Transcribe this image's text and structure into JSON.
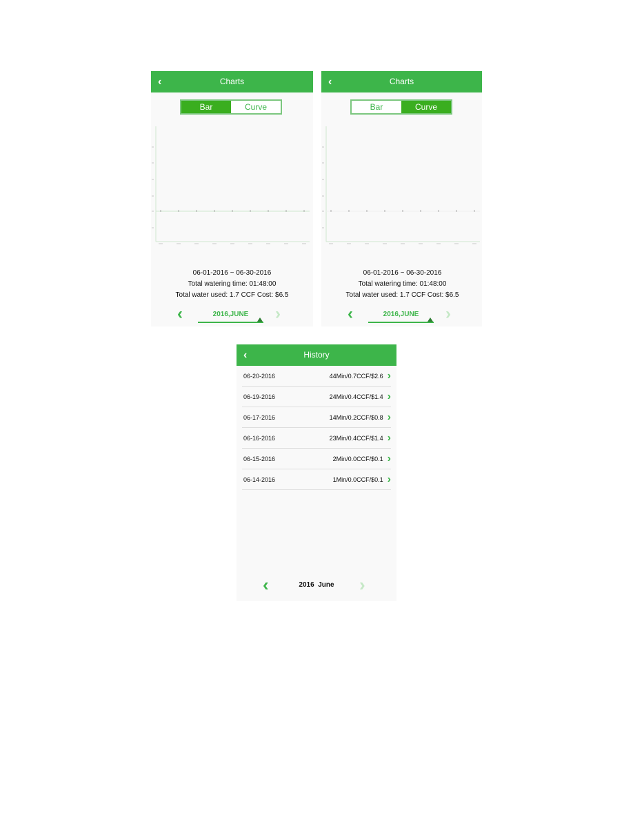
{
  "charts_screens": [
    {
      "title": "Charts",
      "tabs": [
        "Bar",
        "Curve"
      ],
      "active": "Bar",
      "range": "06-01-2016 ~ 06-30-2016",
      "time": "Total watering time: 01:48:00",
      "water": "Total water used: 1.7 CCF  Cost: $6.5",
      "period": "2016,JUNE"
    },
    {
      "title": "Charts",
      "tabs": [
        "Bar",
        "Curve"
      ],
      "active": "Curve",
      "range": "06-01-2016 ~ 06-30-2016",
      "time": "Total watering time: 01:48:00",
      "water": "Total water used: 1.7 CCF  Cost: $6.5",
      "period": "2016,JUNE"
    }
  ],
  "history": {
    "title": "History",
    "rows": [
      {
        "date": "06-20-2016",
        "value": "44Min/0.7CCF/$2.6"
      },
      {
        "date": "06-19-2016",
        "value": "24Min/0.4CCF/$1.4"
      },
      {
        "date": "06-17-2016",
        "value": "14Min/0.2CCF/$0.8"
      },
      {
        "date": "06-16-2016",
        "value": "23Min/0.4CCF/$1.4"
      },
      {
        "date": "06-15-2016",
        "value": "2Min/0.0CCF/$0.1"
      },
      {
        "date": "06-14-2016",
        "value": "1Min/0.0CCF/$0.1"
      }
    ],
    "period": "2016  June"
  },
  "colors": {
    "header": "#3db54a",
    "accent": "#3aae1f"
  },
  "icons": {
    "back": "chevron-left-icon",
    "prev": "chevron-left-icon",
    "next": "chevron-right-icon"
  }
}
